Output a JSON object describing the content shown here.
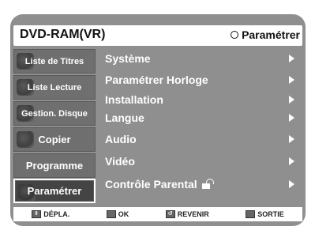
{
  "header": {
    "title": "DVD-RAM(VR)",
    "settings_label": "Paramétrer"
  },
  "sidebar": {
    "items": [
      {
        "label": "Liste de Titres"
      },
      {
        "label": "Liste Lecture"
      },
      {
        "label": "Gestion. Disque"
      },
      {
        "label": "Copier"
      },
      {
        "label": "Programme"
      },
      {
        "label": "Paramétrer"
      }
    ],
    "active_index": 5
  },
  "menu": {
    "items": [
      {
        "label": "Système"
      },
      {
        "label": "Paramétrer  Horloge"
      },
      {
        "label": "Installation"
      },
      {
        "label": "Langue"
      },
      {
        "label": "Audio"
      },
      {
        "label": "Vidéo"
      },
      {
        "label": "Contrôle Parental"
      }
    ]
  },
  "footer": {
    "move": "DÉPLA.",
    "ok": "OK",
    "return": "REVENIR",
    "exit": "SORTIE"
  },
  "colors": {
    "screen_bg": "#8f8f8f",
    "sidebar_item": "#6f6f6f",
    "active_item": "#444444",
    "text_light": "#ffffff",
    "text_dark": "#111111"
  }
}
